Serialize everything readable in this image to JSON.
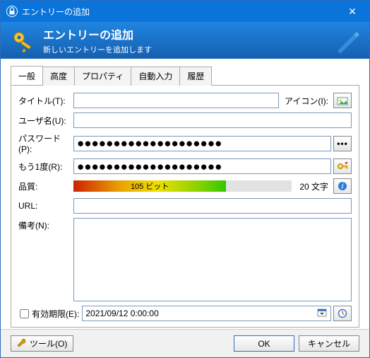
{
  "window": {
    "title": "エントリーの追加"
  },
  "banner": {
    "title": "エントリーの追加",
    "subtitle": "新しいエントリーを追加します"
  },
  "tabs": [
    "一般",
    "高度",
    "プロパティ",
    "自動入力",
    "履歴"
  ],
  "labels": {
    "title": "タイトル(T):",
    "user": "ユーザ名(U):",
    "password": "パスワード(P):",
    "repeat": "もう1度(R):",
    "quality": "品質:",
    "url": "URL:",
    "notes": "備考(N):",
    "icon": "アイコン(I):",
    "expiry": "有効期限(E):"
  },
  "values": {
    "title": "",
    "user": "",
    "password_mask": "●●●●●●●●●●●●●●●●●●●●",
    "repeat_mask": "●●●●●●●●●●●●●●●●●●●●",
    "quality_bits": "105 ビット",
    "chars": "20 文字",
    "url": "",
    "notes": "",
    "expiry": "2021/09/12  0:00:00"
  },
  "buttons": {
    "tools": "ツール(O)",
    "ok": "OK",
    "cancel": "キャンセル"
  },
  "icons": {
    "reveal": "•••",
    "generate": "gen",
    "info": "i",
    "clock": "◷",
    "dropdown": "▾",
    "app": "🔒",
    "close": "✕"
  }
}
